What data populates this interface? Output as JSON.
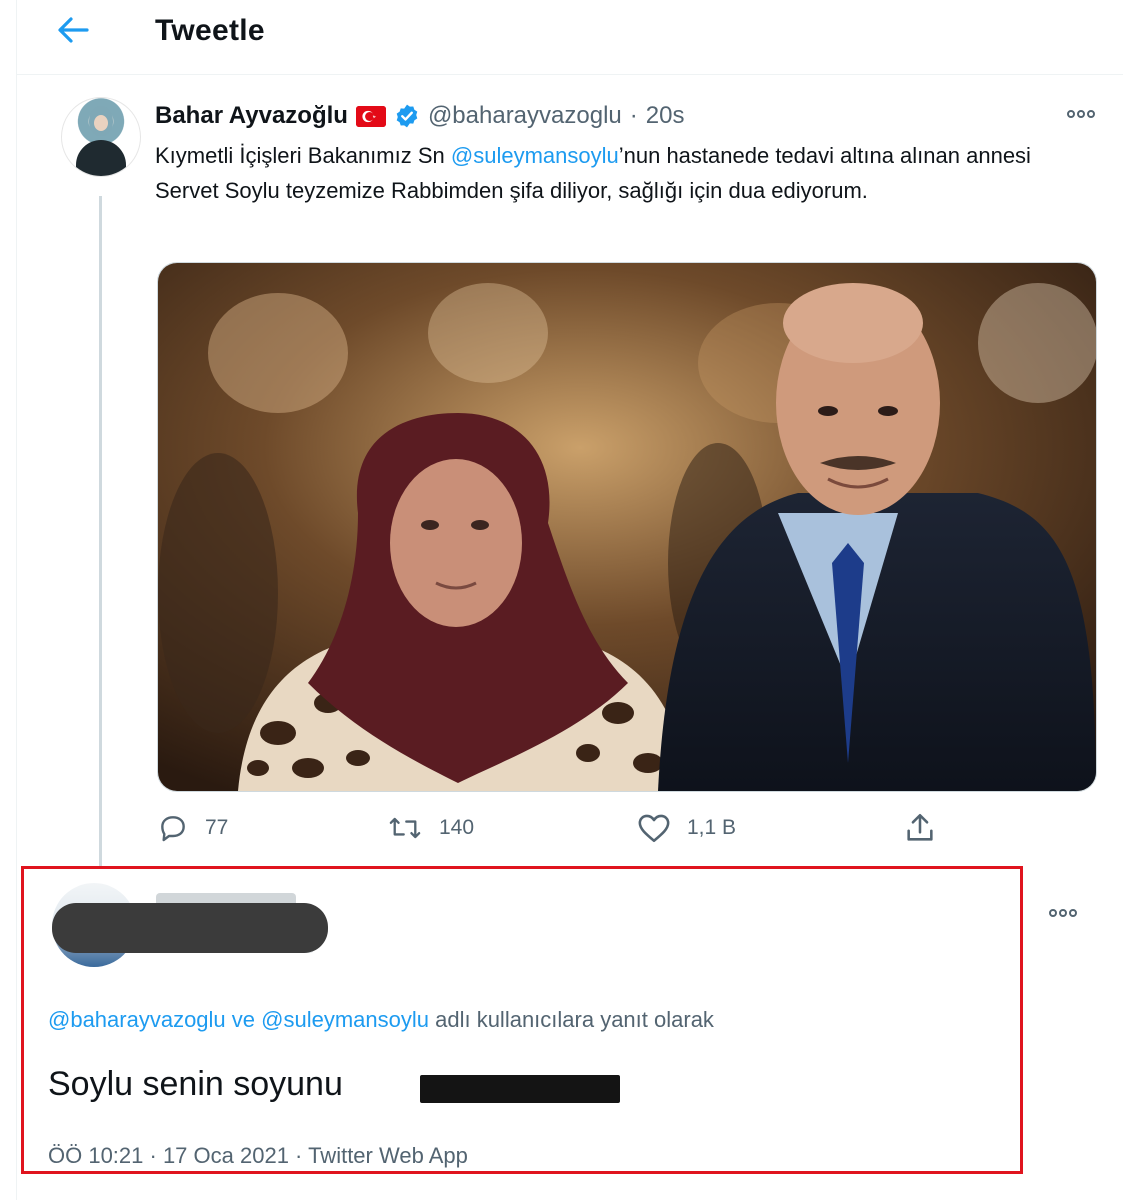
{
  "header": {
    "title": "Tweetle",
    "back_icon": "arrow-left-icon"
  },
  "tweet": {
    "author_name": "Bahar Ayvazoğlu",
    "handle": "@baharayvazoglu",
    "separator": "·",
    "time": "20s",
    "text_part1": "Kıymetli İçişleri Bakanımız Sn ",
    "mention": "@suleymansoylu",
    "text_part2": "’nun hastanede tedavi altına alınan annesi Servet Soylu teyzemize Rabbimden şifa diliyor, sağlığı için dua ediyorum.",
    "media_icon": "photo-icon",
    "replies": "77",
    "retweets": "140",
    "likes": "1,1 B",
    "colors": {
      "accent": "#1d9bf0",
      "muted": "#536471",
      "flag": "#e30a17"
    }
  },
  "reply": {
    "replying_to_mention1": "@baharayvazoglu",
    "replying_to_connector": " ve ",
    "replying_to_mention2": "@suleymansoylu",
    "replying_to_suffix": " adlı kullanıcılara yanıt olarak",
    "text": "Soylu senin soyunu",
    "timestamp": "ÖÖ 10:21 · 17 Oca 2021 · Twitter Web App",
    "highlight_color": "#e0141e"
  }
}
